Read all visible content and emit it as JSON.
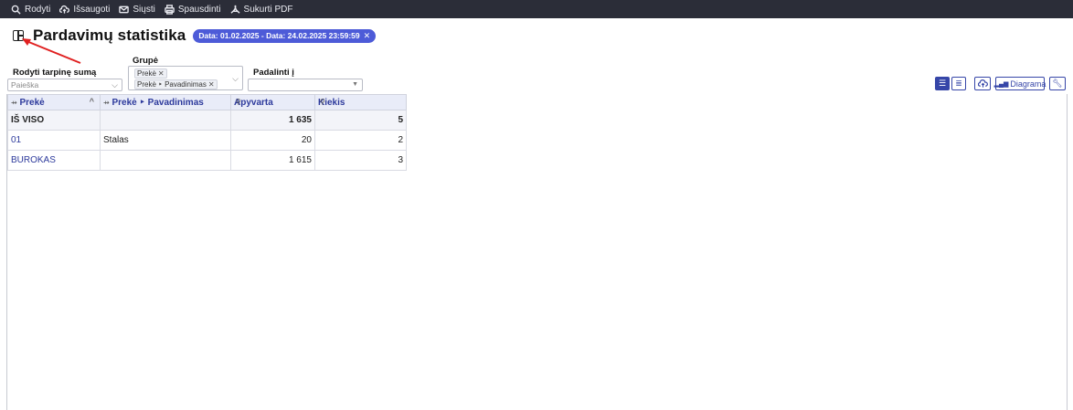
{
  "toolbar": {
    "show": "Rodyti",
    "save": "Išsaugoti",
    "send": "Siųsti",
    "print": "Spausdinti",
    "pdf": "Sukurti PDF"
  },
  "page": {
    "title": "Pardavimų statistika",
    "date_filter": "Data: 01.02.2025 - Data: 24.02.2025 23:59:59"
  },
  "filters": {
    "subtotal_label": "Rodyti tarpinę sumą",
    "subtotal_placeholder": "Paieška",
    "group_label": "Grupė",
    "group_tags": [
      "Prekė",
      "Prekė ‣ Pavadinimas"
    ],
    "split_label": "Padalinti į"
  },
  "tools": {
    "chart_label": "Diagrama"
  },
  "table": {
    "columns": [
      "Prekė",
      "Prekė ‣ Pavadinimas",
      "Apyvarta",
      "Kiekis"
    ],
    "total_row": {
      "label": "IŠ VISO",
      "turnover": "1 635",
      "quantity": "5"
    },
    "rows": [
      {
        "code": "01",
        "name": "Stalas",
        "turnover": "20",
        "quantity": "2"
      },
      {
        "code": "BUROKAS",
        "name": "",
        "turnover": "1 615",
        "quantity": "3"
      }
    ]
  },
  "colors": {
    "topbar": "#2b2d38",
    "accent": "#3646a8",
    "badge": "#4d5bd8",
    "header_bg": "#e9ecf8",
    "arrow": "#e02020"
  }
}
